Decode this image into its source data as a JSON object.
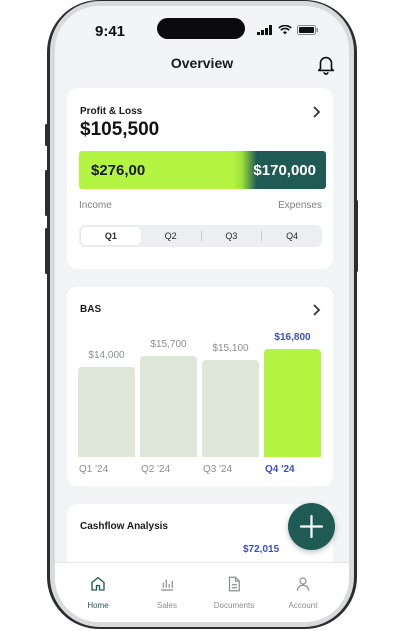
{
  "status_bar": {
    "time": "9:41"
  },
  "header": {
    "title": "Overview"
  },
  "profit_loss": {
    "title": "Profit & Loss",
    "amount": "$105,500",
    "income_value": "$276,00",
    "expenses_value": "$170,000",
    "income_label": "Income",
    "expenses_label": "Expenses",
    "quarters": [
      "Q1",
      "Q2",
      "Q3",
      "Q4"
    ],
    "selected_quarter": "Q1"
  },
  "bas": {
    "title": "BAS",
    "selected_category": "Q4 '24",
    "chart_data": {
      "type": "bar",
      "categories": [
        "Q1 '24",
        "Q2 '24",
        "Q3 '24",
        "Q4 '24"
      ],
      "values": [
        14000,
        15700,
        15100,
        16800
      ],
      "value_labels": [
        "$14,000",
        "$15,700",
        "$15,100",
        "$16,800"
      ],
      "title": "",
      "xlabel": "",
      "ylabel": "",
      "ylim": [
        0,
        17000
      ],
      "grid": false,
      "colors": {
        "default": "#dfe7d9",
        "highlight": "#b4f544"
      },
      "highlight_index": 3
    }
  },
  "cashflow": {
    "title": "Cashflow Analysis",
    "first_value": "$72,015"
  },
  "tabbar": {
    "items": [
      {
        "label": "Home",
        "icon": "home-icon",
        "active": true
      },
      {
        "label": "Sales",
        "icon": "bar-chart-icon",
        "active": false
      },
      {
        "label": "Documents",
        "icon": "document-icon",
        "active": false
      },
      {
        "label": "Account",
        "icon": "user-icon",
        "active": false
      }
    ]
  },
  "colors": {
    "accent_green": "#1f5a55",
    "lime": "#b4f544",
    "highlight_blue": "#3a4fc6"
  }
}
